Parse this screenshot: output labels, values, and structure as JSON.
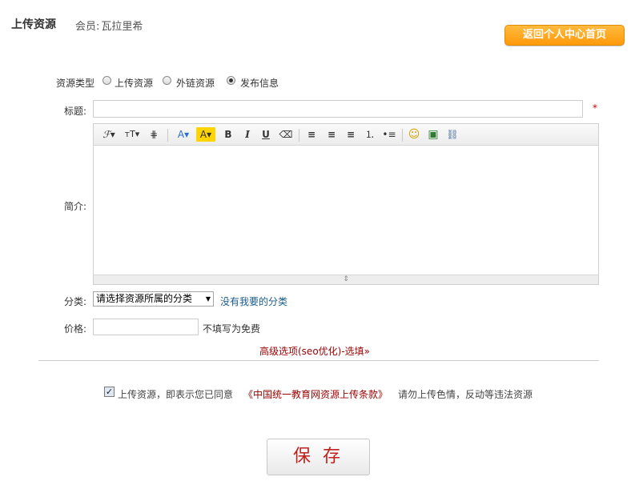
{
  "header": {
    "title": "上传资源",
    "member_label": "会员:",
    "member_name": "瓦拉里希",
    "back_button": "返回个人中心首页"
  },
  "form": {
    "type_label": "资源类型",
    "type_options": [
      {
        "label": "上传资源",
        "checked": false
      },
      {
        "label": "外链资源",
        "checked": false
      },
      {
        "label": "发布信息",
        "checked": true
      }
    ],
    "title_label": "标题:",
    "title_value": "",
    "required_mark": "*",
    "intro_label": "简介:",
    "category_label": "分类:",
    "category_selected": "请选择资源所属的分类",
    "category_link": "没有我要的分类",
    "price_label": "价格:",
    "price_value": "",
    "price_hint": "不填写为免费",
    "advanced_link": "高级选项(seo优化)-选填",
    "agree_checked": true,
    "agree_text": "上传资源，即表示您已同意",
    "terms_link": "《中国统一教育网资源上传条款》",
    "warning_text": "请勿上传色情，反动等违法资源",
    "save_button": "保 存"
  },
  "toolbar": {
    "buttons": [
      {
        "name": "font-family-button",
        "glyph": "ℱ▾"
      },
      {
        "name": "font-size-button",
        "glyph": "ᴛT▾"
      },
      {
        "name": "line-height-button",
        "glyph": "⋕"
      },
      {
        "name": "font-color-button",
        "glyph": "A▾"
      },
      {
        "name": "highlight-color-button",
        "glyph": "A▾"
      },
      {
        "name": "bold-button",
        "glyph": "B"
      },
      {
        "name": "italic-button",
        "glyph": "I"
      },
      {
        "name": "underline-button",
        "glyph": "U"
      },
      {
        "name": "eraser-button",
        "glyph": "⌫"
      },
      {
        "name": "align-left-button",
        "glyph": "≡"
      },
      {
        "name": "align-center-button",
        "glyph": "≡"
      },
      {
        "name": "align-right-button",
        "glyph": "≡"
      },
      {
        "name": "ordered-list-button",
        "glyph": "⒈"
      },
      {
        "name": "unordered-list-button",
        "glyph": "•≡"
      },
      {
        "name": "emoticon-button",
        "glyph": "☺"
      },
      {
        "name": "image-button",
        "glyph": "▣"
      },
      {
        "name": "link-button",
        "glyph": "⛓"
      }
    ]
  },
  "colors": {
    "accent_orange": "#ff9a0a",
    "link_blue": "#1a5c8c",
    "dark_red": "#990000",
    "save_red": "#c0201e"
  }
}
